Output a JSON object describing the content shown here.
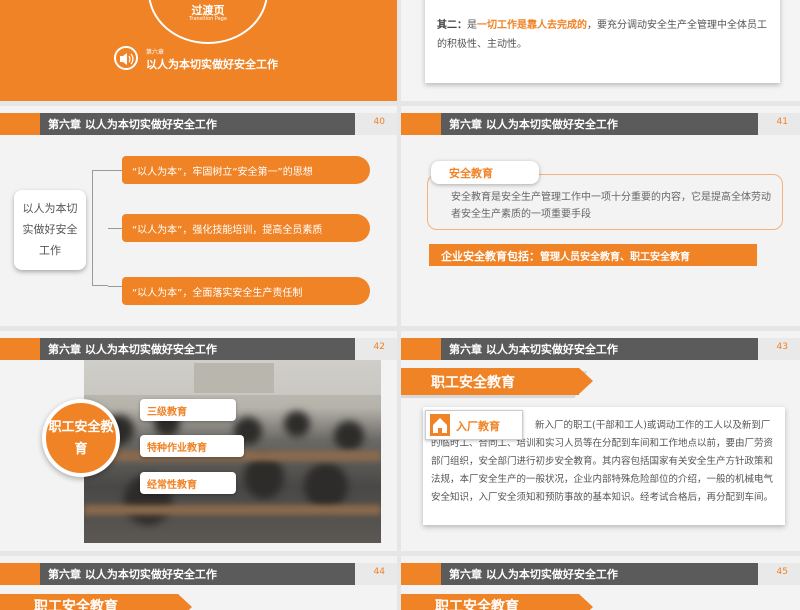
{
  "transition": {
    "title": "过渡页",
    "subtitle": "Transition Page",
    "chapter_small": "第六章",
    "chapter_title": "以人为本切实做好安全工作"
  },
  "slide_prev": {
    "point_label": "其二：",
    "point_pre": "是",
    "point_highlight": "一切工作是靠人去完成的",
    "point_post": "，要充分调动安全生产全管理中全体员工的积极性、主动性。"
  },
  "header_title": "第六章  以人为本切实做好安全工作",
  "slide40": {
    "number": "40",
    "box_text": "以人为本切实做好安全工作",
    "items": [
      "“以人为本”，牢固树立“安全第一”的思想",
      "“以人为本”，强化技能培训，提高全员素质",
      "“以人为本”，全面落实安全生产责任制"
    ]
  },
  "slide41": {
    "number": "41",
    "tag": "安全教育",
    "text": "安全教育是安全生产管理工作中一项十分重要的内容，它是提高全体劳动者安全生产素质的一项重要手段",
    "bar_head": "企业安全教育包括：",
    "bar_body": "管理人员安全教育、职工安全教育"
  },
  "slide42": {
    "number": "42",
    "circle_text": "职工安全教育",
    "labels": [
      "三级教育",
      "特种作业教育",
      "经常性教育"
    ]
  },
  "slide43": {
    "number": "43",
    "heading": "职工安全教育",
    "sub_label": "入厂教育",
    "text": "新入厂的职工(干部和工人)或调动工作的工人以及新到厂的临时工、合同工、培训和实习人员等在分配到车间和工作地点以前，要由厂劳资部门组织，安全部门进行初步安全教育。其内容包括国家有关安全生产方针政策和法规，本厂安全生产的一般状况，企业内部特殊危险部位的介绍，一般的机械电气安全知识，入厂安全须知和预防事故的基本知识。经考试合格后，再分配到车间。"
  },
  "slide44": {
    "number": "44",
    "heading": "职工安全教育"
  },
  "slide45": {
    "number": "45",
    "heading": "职工安全教育"
  },
  "colors": {
    "accent": "#f08326",
    "header": "#5b5b5b"
  }
}
